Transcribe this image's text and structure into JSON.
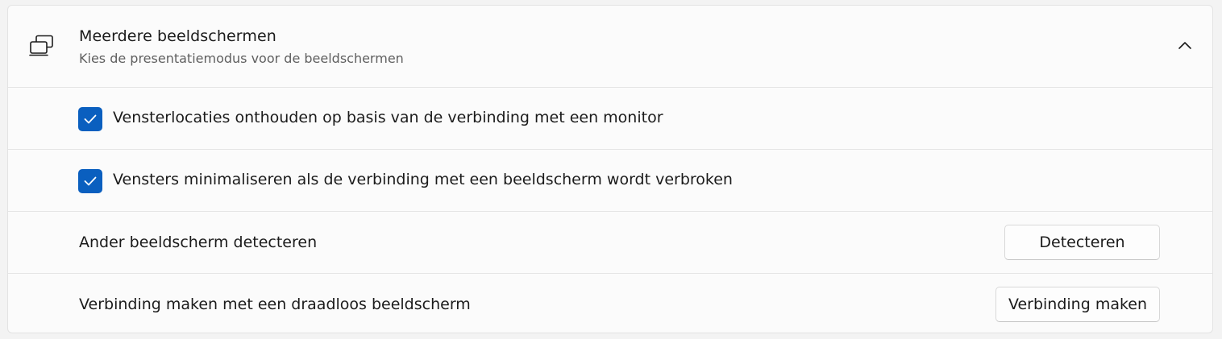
{
  "section": {
    "title": "Meerdere beeldschermen",
    "subtitle": "Kies de presentatiemodus voor de beeldschermen",
    "icon": "multiple-displays-icon",
    "expanded": true
  },
  "options": [
    {
      "label": "Vensterlocaties onthouden op basis van de verbinding met een monitor",
      "checked": true
    },
    {
      "label": "Vensters minimaliseren als de verbinding met een beeldscherm wordt verbroken",
      "checked": true
    }
  ],
  "detect": {
    "label": "Ander beeldscherm detecteren",
    "button": "Detecteren"
  },
  "wireless": {
    "label": "Verbinding maken met een draadloos beeldscherm",
    "button": "Verbinding maken"
  },
  "colors": {
    "accent": "#0a5fbf",
    "panel": "#fbfbfb",
    "background": "#f3f3f3"
  }
}
